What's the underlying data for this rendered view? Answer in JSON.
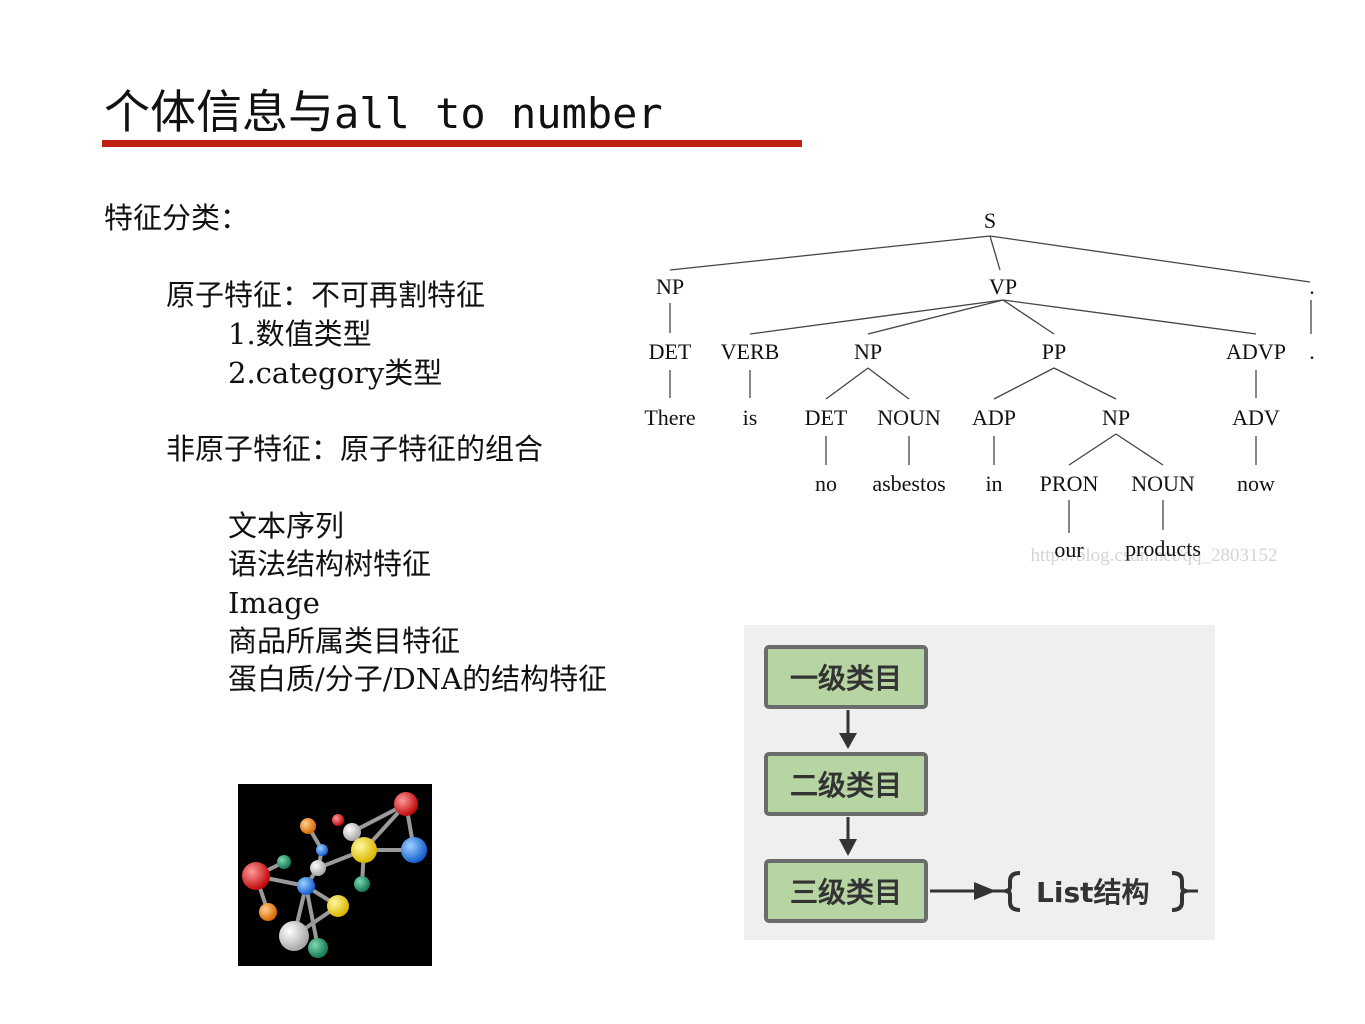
{
  "slide": {
    "title_cn": "个体信息与",
    "title_en": "all to number",
    "feature_heading": "特征分类：",
    "atomic": {
      "heading": "原子特征：不可再割特征",
      "items": [
        "1.数值类型",
        "2.category类型"
      ]
    },
    "non_atomic": {
      "heading": "非原子特征：原子特征的组合",
      "items": [
        "文本序列",
        "语法结构树特征",
        "Image",
        "商品所属类目特征",
        "蛋白质/分子/DNA的结构特征"
      ]
    }
  },
  "parse_tree": {
    "root": "S",
    "nodes": {
      "np1": "NP",
      "vp": "VP",
      "punct_tag": ".",
      "det1": "DET",
      "verb": "VERB",
      "np2": "NP",
      "pp": "PP",
      "advp": "ADVP",
      "punct_tag2": ".",
      "word_there": "There",
      "word_is": "is",
      "det2": "DET",
      "noun1": "NOUN",
      "adp": "ADP",
      "np3": "NP",
      "adv": "ADV",
      "word_no": "no",
      "word_asbestos": "asbestos",
      "word_in": "in",
      "pron": "PRON",
      "noun2": "NOUN",
      "word_now": "now",
      "word_our": "our",
      "word_products": "products"
    },
    "watermark": "http://blog.csdn.net/qq_2803152"
  },
  "category_flow": {
    "levels": [
      "一级类目",
      "二级类目",
      "三级类目"
    ],
    "list_label": "List结构"
  },
  "colors": {
    "title_rule": "#c0200f",
    "box_fill": "#b7d5a3",
    "box_border": "#6b6b6b",
    "flow_bg": "#efefef"
  }
}
